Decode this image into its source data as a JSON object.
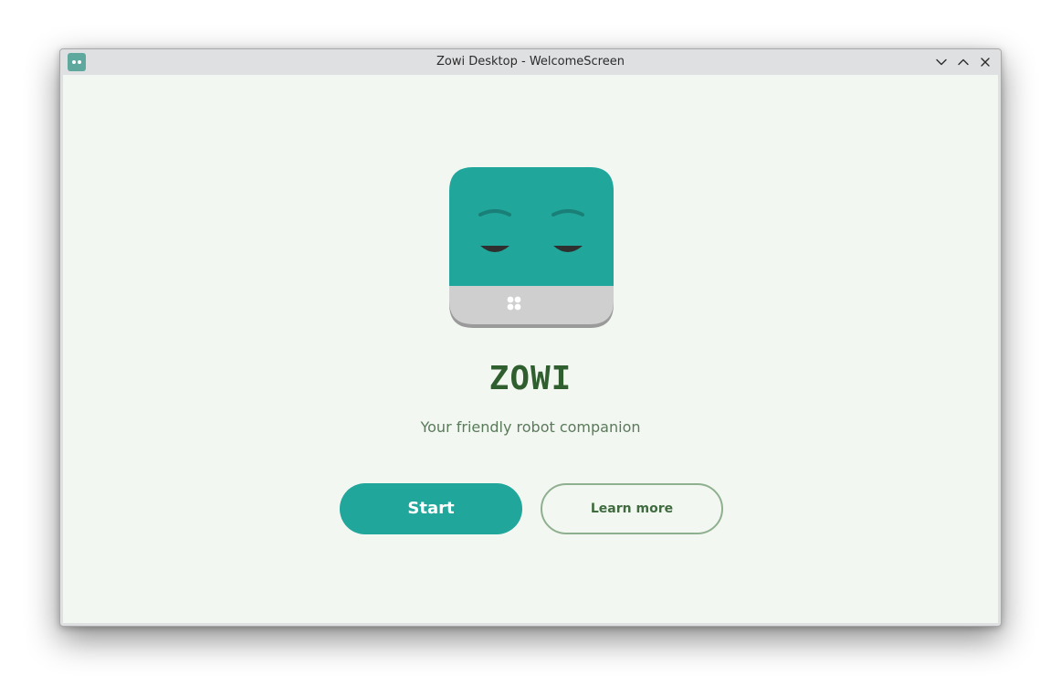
{
  "window": {
    "title": "Zowi Desktop - WelcomeScreen",
    "icon": "zowi-app-icon",
    "controls": {
      "minimize_icon": "chevron-down-icon",
      "maximize_icon": "chevron-up-icon",
      "close_icon": "close-icon"
    }
  },
  "welcome": {
    "logo_icon": "zowi-robot-face",
    "brand": "ZOWI",
    "tagline": "Your friendly robot companion",
    "start_label": "Start",
    "learn_more_label": "Learn more"
  },
  "colors": {
    "accent": "#20a69b",
    "background": "#f3f7f2",
    "brand_text": "#2f5f2f",
    "outline_button_border": "#8fb08f"
  }
}
